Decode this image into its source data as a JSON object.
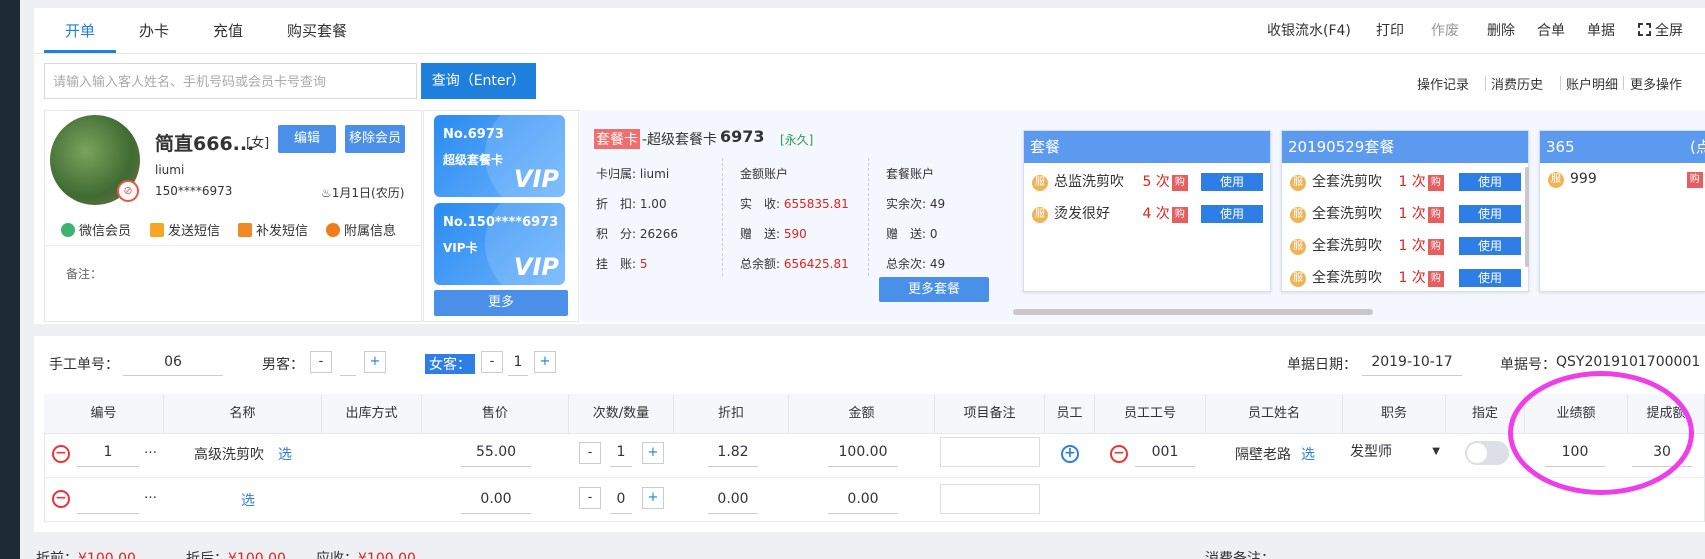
{
  "tabs": [
    "开单",
    "办卡",
    "充值",
    "购买套餐"
  ],
  "toolbar": {
    "cashier_flow": "收银流水(F4)",
    "print": "打印",
    "void": "作废",
    "delete": "删除",
    "merge": "合单",
    "receipt": "单据",
    "fullscreen": "全屏"
  },
  "search": {
    "placeholder": "请输入输入客人姓名、手机号码或会员卡号查询",
    "button": "查询（Enter）"
  },
  "links": [
    "操作记录",
    "消费历史",
    "账户明细",
    "更多操作"
  ],
  "member": {
    "name": "简直666...",
    "gender": "[女]",
    "edit": "编辑",
    "remove": "移除会员",
    "username": "liumi",
    "phone": "150****6973",
    "birthday": "1月1日(农历)",
    "actions": [
      "微信会员",
      "发送短信",
      "补发短信",
      "附属信息"
    ],
    "note_label": "备注："
  },
  "vip_cards": [
    {
      "no": "No.6973",
      "type": "超级套餐卡",
      "badge": "VIP"
    },
    {
      "no": "No.150****6973",
      "type": "VIP卡",
      "badge": "VIP"
    }
  ],
  "more_cards": "更多",
  "card_detail": {
    "tag": "套餐卡",
    "title": "-超级套餐卡",
    "number": "6973",
    "validity": "[永久]",
    "owner": "卡归属: liumi",
    "discount": "折　扣: 1.00",
    "points": "积　分: 26266",
    "credit_label": "挂　账:",
    "credit_value": "5",
    "amount_title": "金额账户",
    "actual_label": "实　收:",
    "actual_value": "655835.81",
    "gift_label": "赠　送:",
    "gift_value": "590",
    "total_label": "总余额:",
    "total_value": "656425.81",
    "pkg_title": "套餐账户",
    "pkg_real": "实余次: 49",
    "pkg_gift": "赠　送: 0",
    "pkg_total": "总余次: 49",
    "more_pkg": "更多套餐"
  },
  "packages": [
    {
      "title": "套餐",
      "items": [
        {
          "icon": "服",
          "name": "总监洗剪吹",
          "times": "5 次",
          "buy": "购",
          "use": "使用"
        },
        {
          "icon": "服",
          "name": "烫发很好",
          "times": "4 次",
          "buy": "购",
          "use": "使用"
        }
      ]
    },
    {
      "title": "20190529套餐",
      "items": [
        {
          "icon": "服",
          "name": "全套洗剪吹",
          "times": "1 次",
          "buy": "购",
          "use": "使用"
        },
        {
          "icon": "服",
          "name": "全套洗剪吹",
          "times": "1 次",
          "buy": "购",
          "use": "使用"
        },
        {
          "icon": "服",
          "name": "全套洗剪吹",
          "times": "1 次",
          "buy": "购",
          "use": "使用"
        },
        {
          "icon": "服",
          "name": "全套洗剪吹",
          "times": "1 次",
          "buy": "购",
          "use": "使用"
        }
      ]
    },
    {
      "title": "365",
      "title_right": "(点",
      "items": [
        {
          "icon": "服",
          "name": "999",
          "times": "",
          "buy": "购",
          "use": ""
        }
      ]
    }
  ],
  "order": {
    "manual_no_label": "手工单号：",
    "manual_no": "06",
    "male_label": "男客：",
    "male_count": "",
    "female_label": "女客：",
    "female_count": "1",
    "date_label": "单据日期：",
    "date": "2019-10-17",
    "bill_no_label": "单据号：",
    "bill_no": "QSY2019101700001"
  },
  "table": {
    "headers": [
      "编号",
      "名称",
      "出库方式",
      "售价",
      "次数/数量",
      "折扣",
      "金额",
      "项目备注",
      "员工",
      "员工工号",
      "员工姓名",
      "职务",
      "指定",
      "业绩额",
      "提成额"
    ],
    "rows": [
      {
        "no": "1",
        "name": "高级洗剪吹",
        "select": "选",
        "price": "55.00",
        "qty": "1",
        "discount": "1.82",
        "amount": "100.00",
        "emp_no": "001",
        "emp_name": "隔壁老路",
        "emp_select": "选",
        "role": "发型师",
        "perf": "100",
        "commission": "30"
      },
      {
        "no": "",
        "name": "",
        "select": "选",
        "price": "0.00",
        "qty": "0",
        "discount": "0.00",
        "amount": "0.00"
      }
    ]
  },
  "footer": {
    "before_label": "折前：",
    "before": "¥100.00",
    "after_label": "折后：",
    "after": "¥100.00",
    "due_label": "应收：",
    "due": "¥100.00",
    "remark_label": "消费备注："
  }
}
